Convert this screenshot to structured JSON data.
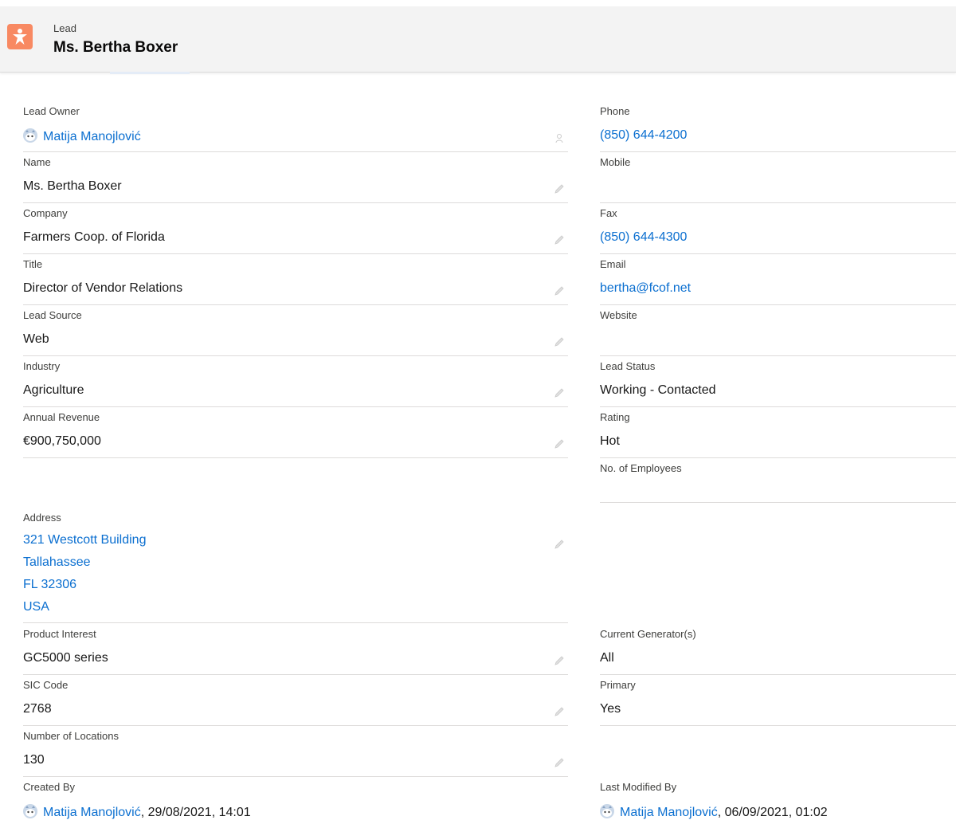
{
  "header": {
    "object_type": "Lead",
    "record_name": "Ms. Bertha Boxer",
    "icon": "lead-icon",
    "icon_color": "#f88962"
  },
  "left": {
    "lead_owner": {
      "label": "Lead Owner",
      "value": "Matija Manojlović"
    },
    "name": {
      "label": "Name",
      "value": "Ms. Bertha Boxer"
    },
    "company": {
      "label": "Company",
      "value": "Farmers Coop. of Florida"
    },
    "title": {
      "label": "Title",
      "value": "Director of Vendor Relations"
    },
    "lead_source": {
      "label": "Lead Source",
      "value": "Web"
    },
    "industry": {
      "label": "Industry",
      "value": "Agriculture"
    },
    "annual_revenue": {
      "label": "Annual Revenue",
      "value": "€900,750,000"
    },
    "address": {
      "label": "Address",
      "line1": "321 Westcott Building",
      "line2": "Tallahassee",
      "line3": "FL 32306",
      "line4": "USA"
    },
    "product_interest": {
      "label": "Product Interest",
      "value": "GC5000 series"
    },
    "sic_code": {
      "label": "SIC Code",
      "value": "2768"
    },
    "number_of_locations": {
      "label": "Number of Locations",
      "value": "130"
    },
    "created_by": {
      "label": "Created By",
      "user": "Matija Manojlović",
      "date": ", 29/08/2021, 14:01"
    }
  },
  "right": {
    "phone": {
      "label": "Phone",
      "value": "(850) 644-4200"
    },
    "mobile": {
      "label": "Mobile",
      "value": ""
    },
    "fax": {
      "label": "Fax",
      "value": "(850) 644-4300"
    },
    "email": {
      "label": "Email",
      "value": "bertha@fcof.net"
    },
    "website": {
      "label": "Website",
      "value": ""
    },
    "lead_status": {
      "label": "Lead Status",
      "value": "Working - Contacted"
    },
    "rating": {
      "label": "Rating",
      "value": "Hot"
    },
    "no_of_employees": {
      "label": "No. of Employees",
      "value": ""
    },
    "current_generators": {
      "label": "Current Generator(s)",
      "value": "All"
    },
    "primary": {
      "label": "Primary",
      "value": "Yes"
    },
    "last_modified_by": {
      "label": "Last Modified By",
      "user": "Matija Manojlović",
      "date": ", 06/09/2021, 01:02"
    }
  },
  "colors": {
    "link": "#0b6fd0",
    "divider": "#dddbda",
    "header_bg": "#f3f3f3"
  }
}
